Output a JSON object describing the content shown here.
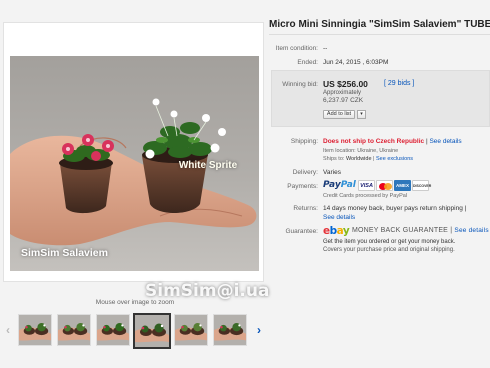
{
  "listing": {
    "title": "Micro Mini Sinningia \"SimSim Salaviem\" TUBER,",
    "condition_label": "Item condition:",
    "condition_value": "--",
    "ended_label": "Ended:",
    "ended_value": "Jun 24, 2015 , 6:03PM",
    "winning_bid_label": "Winning bid:",
    "winning_bid_price": "US $256.00",
    "bid_count": "[ 29 bids ]",
    "approximately": "Approximately",
    "czk_price": "6,237.97 CZK",
    "add_to_list": "Add to list",
    "add_to_list_caret": "▾"
  },
  "shipping": {
    "label": "Shipping:",
    "warning": "Does not ship to Czech Republic",
    "separator": "|",
    "see_details": "See details",
    "item_location": "Item location: Ukraine, Ukraine",
    "ships_to_label": "Ships to:",
    "ships_to_value": "Worldwide",
    "exclusions_sep": "|",
    "see_exclusions": "See exclusions"
  },
  "delivery": {
    "label": "Delivery:",
    "value": "Varies"
  },
  "payments": {
    "label": "Payments:",
    "paypal_1": "Pay",
    "paypal_2": "Pal",
    "visa": "VISA",
    "amex": "AMEX",
    "discover": "DISCOVER",
    "credit_note": "Credit Cards processed by PayPal"
  },
  "returns": {
    "label": "Returns:",
    "line1": "14 days money back, buyer pays return shipping |",
    "details": "See details"
  },
  "guarantee": {
    "label": "Guarantee:",
    "ebay_e": "e",
    "ebay_b": "b",
    "ebay_a": "a",
    "ebay_y": "y",
    "mbg": "MONEY BACK GUARANTEE",
    "separator": "|",
    "see_details": "See details",
    "line1": "Get the item you ordered or get your money back.",
    "line2": "Covers your purchase price and original shipping."
  },
  "gallery": {
    "caption_sprite": "White Sprite",
    "caption_sim": "SimSim Salaviem",
    "watermark": "SimSim@i.ua",
    "hover_note": "Mouse over image to zoom",
    "left_arrow": "‹",
    "right_arrow": "›",
    "thumbnail_count": 6,
    "active_thumbnail": 4
  },
  "colors": {
    "link": "#0654ba",
    "warning": "#dd1e31",
    "bid_box": "#e6e6e6"
  }
}
